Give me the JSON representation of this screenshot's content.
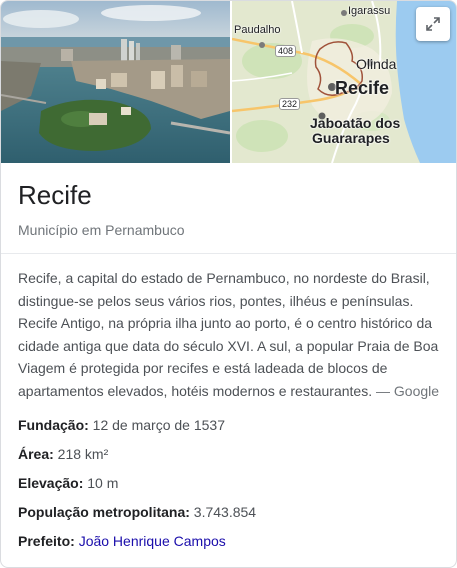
{
  "map": {
    "labels": {
      "igarassu": "Igarassu",
      "paudalho": "Paudalho",
      "olinda": "Olinda",
      "recife": "Recife",
      "jaboatao_line1": "Jaboatão dos",
      "jaboatao_line2": "Guararapes",
      "road_408": "408",
      "road_232": "232"
    },
    "expand_icon": "expand-icon"
  },
  "header": {
    "title": "Recife",
    "subtitle": "Município em Pernambuco"
  },
  "description": {
    "text": "Recife, a capital do estado de Pernambuco, no nordeste do Brasil, distingue-se pelos seus vários rios, pontes, ilhéus e penínsulas. Recife Antigo, na própria ilha junto ao porto, é o centro histórico da cidade antiga que data do século XVI. A sul, a popular Praia de Boa Viagem é protegida por recifes e está ladeada de blocos de apartamentos elevados, hotéis modernos e restaurantes.",
    "source": " — Google"
  },
  "facts": {
    "fundacao": {
      "label": "Fundação:",
      "value": " 12 de março de 1537"
    },
    "area": {
      "label": "Área:",
      "value": " 218 km²"
    },
    "elevacao": {
      "label": "Elevação:",
      "value": " 10 m"
    },
    "populacao": {
      "label": "População metropolitana:",
      "value": " 3.743.854"
    },
    "prefeito": {
      "label": "Prefeito:",
      "value": "João Henrique Campos"
    }
  },
  "colors": {
    "link": "#1a0dab",
    "sea": "#9ccbf0",
    "land": "#e3e8cf"
  }
}
